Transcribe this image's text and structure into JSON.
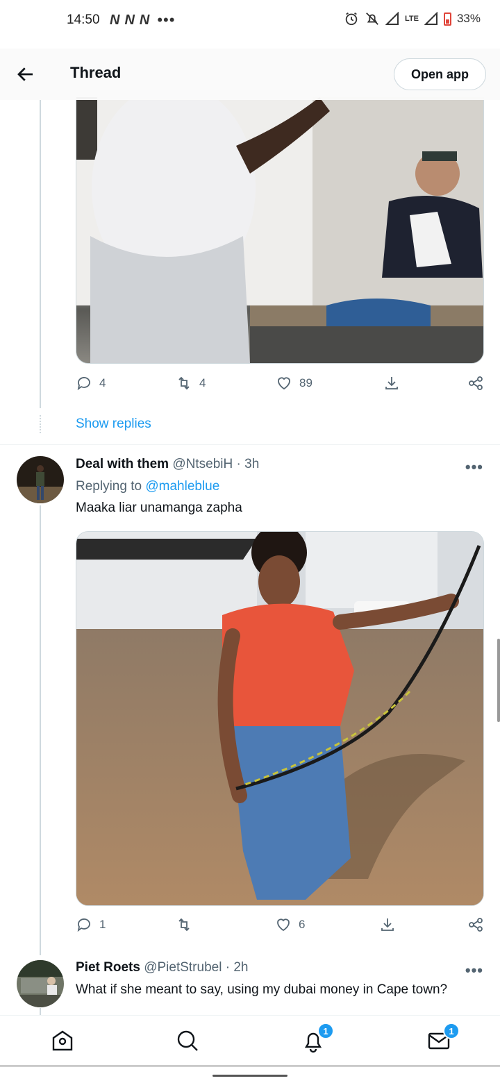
{
  "status_bar": {
    "time": "14:50",
    "carriers": [
      "N",
      "N",
      "N"
    ],
    "more": "•••",
    "network": "LTE",
    "battery": "33%"
  },
  "header": {
    "title": "Thread",
    "open_app_label": "Open app"
  },
  "tweet1": {
    "replies": "4",
    "retweets": "4",
    "likes": "89",
    "show_replies": "Show replies"
  },
  "tweet2": {
    "name": "Deal with them",
    "handle": "@NtsebiH",
    "time": "· 3h",
    "replying_prefix": "Replying to",
    "replying_handle": "@mahleblue",
    "text": "Maaka liar unamanga zapha",
    "replies": "1",
    "retweets": "",
    "likes": "6",
    "more": "•••"
  },
  "tweet3": {
    "name": "Piet Roets",
    "handle": "@PietStrubel",
    "time": "· 2h",
    "text": "What if she meant to say, using my dubai money in Cape town?",
    "more": "•••"
  },
  "bottom_nav": {
    "notifications_badge": "1",
    "messages_badge": "1"
  },
  "icons": {
    "back": "arrow-left-icon",
    "reply": "reply-icon",
    "retweet": "retweet-icon",
    "like": "heart-icon",
    "share": "share-icon",
    "download": "download-icon",
    "home": "home-icon",
    "search": "search-icon",
    "notifications": "bell-icon",
    "messages": "mail-icon"
  },
  "colors": {
    "accent": "#1d9bf0",
    "text": "#0f1419",
    "muted": "#536471",
    "border": "#cfd9de"
  }
}
